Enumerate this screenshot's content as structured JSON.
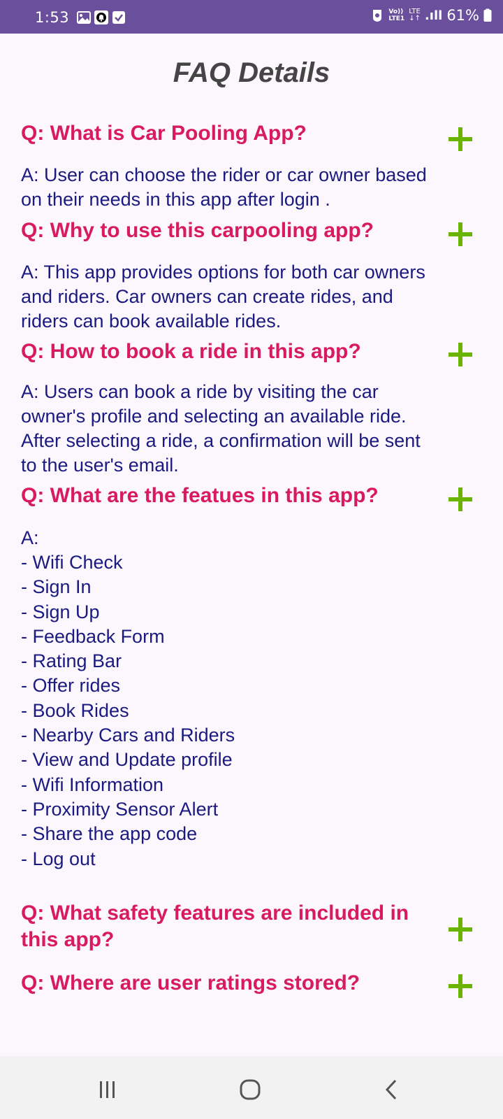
{
  "status_bar": {
    "time": "1:53",
    "volte_top": "Vo))",
    "volte_bottom": "LTE1",
    "lte_top": "LTE",
    "lte_bottom": "↓↑",
    "signal": ".ıll",
    "battery": "61%",
    "icons": [
      "gallery-icon",
      "notification-bell-icon",
      "checkbox-icon",
      "hotspot-icon",
      "signal-icon",
      "battery-icon"
    ]
  },
  "page": {
    "title": "FAQ Details"
  },
  "faqs": [
    {
      "question": "Q: What is Car Pooling App?",
      "answer": "A: User can choose the rider or car owner based\non their needs in this app after login ."
    },
    {
      "question": "Q: Why to use this carpooling app?",
      "answer": "A: This app provides options for both car owners\nand riders. Car owners can create rides, and\nriders can book available rides."
    },
    {
      "question": "Q: How to book a ride in this app?",
      "answer": "A: Users can book a ride by visiting the car\nowner's profile and selecting an available ride.\nAfter selecting a ride, a confirmation will be sent\nto the user's email."
    },
    {
      "question": "Q: What are the featues in this app?",
      "answer": "A:",
      "list": [
        "- Wifi Check",
        "- Sign In",
        "- Sign Up",
        "- Feedback Form",
        "- Rating Bar",
        "- Offer rides",
        "- Book Rides",
        "- Nearby Cars and Riders",
        "- View and Update profile",
        "- Wifi Information",
        "- Proximity Sensor Alert",
        "- Share the app code",
        "- Log out"
      ]
    },
    {
      "question": "Q: What safety features are included in\nthis app?"
    },
    {
      "question": "Q: Where are user ratings stored?"
    }
  ],
  "colors": {
    "status_bar": "#6a4f9d",
    "background": "#fcf7fc",
    "title": "#454545",
    "question": "#d81b60",
    "answer": "#1a1a80",
    "plus": "#6ab400"
  },
  "nav_bar": {
    "icons": [
      "recent-apps-icon",
      "home-icon",
      "back-icon"
    ]
  }
}
